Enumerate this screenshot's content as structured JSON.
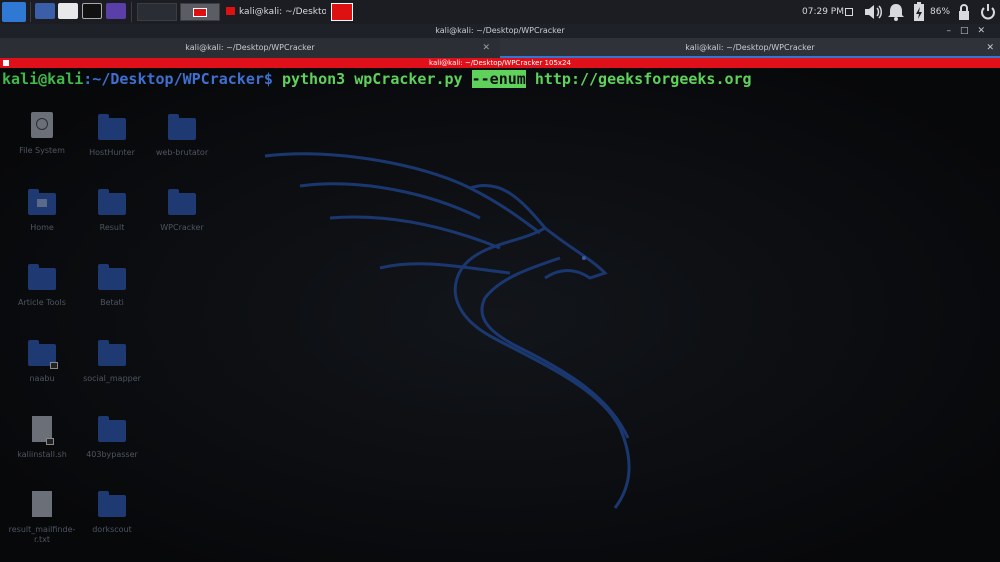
{
  "panel": {
    "task_title": "kali@kali: ~/Desktop/W...",
    "clock": "07:29 PM",
    "battery": "86%",
    "icons": [
      "kali-menu-icon",
      "show-desktop-icon",
      "file-manager-icon",
      "terminal-icon",
      "record-icon",
      "volume-icon",
      "notification-icon",
      "battery-icon",
      "lock-icon",
      "power-icon"
    ]
  },
  "window": {
    "title": "kali@kali: ~/Desktop/WPCracker",
    "tabs": [
      {
        "label": "kali@kali: ~/Desktop/WPCracker"
      },
      {
        "label": "kali@kali: ~/Desktop/WPCracker"
      }
    ],
    "status": "kali@kali: ~/Desktop/WPCracker 105x24"
  },
  "terminal": {
    "user": "kali@kali",
    "path": ":~/Desktop/WPCracker",
    "dollar": "$",
    "cmd_before": " python3 wpCracker.py ",
    "cmd_flag": "--enum",
    "cmd_after": " http://geeksforgeeks.org"
  },
  "desktop": {
    "icons": [
      {
        "label": "File System"
      },
      {
        "label": "HostHunter"
      },
      {
        "label": "web-brutator"
      },
      {
        "label": "Home"
      },
      {
        "label": "Result"
      },
      {
        "label": "WPCracker"
      },
      {
        "label": "Article Tools"
      },
      {
        "label": "Betati"
      },
      {
        "label": "naabu"
      },
      {
        "label": "social_mapper"
      },
      {
        "label": "kaliinstall.sh"
      },
      {
        "label": "403bypasser"
      },
      {
        "label": "result_mailfinde-r.txt"
      },
      {
        "label": "dorkscout"
      }
    ]
  },
  "colors": {
    "accent": "#2f78d4",
    "alert_red": "#e0101a",
    "prompt_green": "#3fb94a",
    "path_blue": "#3f6fd0"
  }
}
